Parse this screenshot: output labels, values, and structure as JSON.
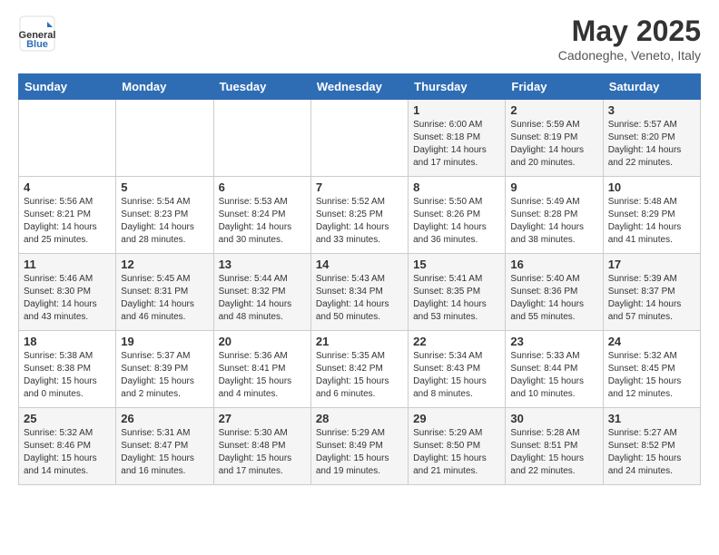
{
  "logo": {
    "general": "General",
    "blue": "Blue"
  },
  "title": "May 2025",
  "subtitle": "Cadoneghe, Veneto, Italy",
  "headers": [
    "Sunday",
    "Monday",
    "Tuesday",
    "Wednesday",
    "Thursday",
    "Friday",
    "Saturday"
  ],
  "weeks": [
    [
      {
        "day": "",
        "info": ""
      },
      {
        "day": "",
        "info": ""
      },
      {
        "day": "",
        "info": ""
      },
      {
        "day": "",
        "info": ""
      },
      {
        "day": "1",
        "info": "Sunrise: 6:00 AM\nSunset: 8:18 PM\nDaylight: 14 hours\nand 17 minutes."
      },
      {
        "day": "2",
        "info": "Sunrise: 5:59 AM\nSunset: 8:19 PM\nDaylight: 14 hours\nand 20 minutes."
      },
      {
        "day": "3",
        "info": "Sunrise: 5:57 AM\nSunset: 8:20 PM\nDaylight: 14 hours\nand 22 minutes."
      }
    ],
    [
      {
        "day": "4",
        "info": "Sunrise: 5:56 AM\nSunset: 8:21 PM\nDaylight: 14 hours\nand 25 minutes."
      },
      {
        "day": "5",
        "info": "Sunrise: 5:54 AM\nSunset: 8:23 PM\nDaylight: 14 hours\nand 28 minutes."
      },
      {
        "day": "6",
        "info": "Sunrise: 5:53 AM\nSunset: 8:24 PM\nDaylight: 14 hours\nand 30 minutes."
      },
      {
        "day": "7",
        "info": "Sunrise: 5:52 AM\nSunset: 8:25 PM\nDaylight: 14 hours\nand 33 minutes."
      },
      {
        "day": "8",
        "info": "Sunrise: 5:50 AM\nSunset: 8:26 PM\nDaylight: 14 hours\nand 36 minutes."
      },
      {
        "day": "9",
        "info": "Sunrise: 5:49 AM\nSunset: 8:28 PM\nDaylight: 14 hours\nand 38 minutes."
      },
      {
        "day": "10",
        "info": "Sunrise: 5:48 AM\nSunset: 8:29 PM\nDaylight: 14 hours\nand 41 minutes."
      }
    ],
    [
      {
        "day": "11",
        "info": "Sunrise: 5:46 AM\nSunset: 8:30 PM\nDaylight: 14 hours\nand 43 minutes."
      },
      {
        "day": "12",
        "info": "Sunrise: 5:45 AM\nSunset: 8:31 PM\nDaylight: 14 hours\nand 46 minutes."
      },
      {
        "day": "13",
        "info": "Sunrise: 5:44 AM\nSunset: 8:32 PM\nDaylight: 14 hours\nand 48 minutes."
      },
      {
        "day": "14",
        "info": "Sunrise: 5:43 AM\nSunset: 8:34 PM\nDaylight: 14 hours\nand 50 minutes."
      },
      {
        "day": "15",
        "info": "Sunrise: 5:41 AM\nSunset: 8:35 PM\nDaylight: 14 hours\nand 53 minutes."
      },
      {
        "day": "16",
        "info": "Sunrise: 5:40 AM\nSunset: 8:36 PM\nDaylight: 14 hours\nand 55 minutes."
      },
      {
        "day": "17",
        "info": "Sunrise: 5:39 AM\nSunset: 8:37 PM\nDaylight: 14 hours\nand 57 minutes."
      }
    ],
    [
      {
        "day": "18",
        "info": "Sunrise: 5:38 AM\nSunset: 8:38 PM\nDaylight: 15 hours\nand 0 minutes."
      },
      {
        "day": "19",
        "info": "Sunrise: 5:37 AM\nSunset: 8:39 PM\nDaylight: 15 hours\nand 2 minutes."
      },
      {
        "day": "20",
        "info": "Sunrise: 5:36 AM\nSunset: 8:41 PM\nDaylight: 15 hours\nand 4 minutes."
      },
      {
        "day": "21",
        "info": "Sunrise: 5:35 AM\nSunset: 8:42 PM\nDaylight: 15 hours\nand 6 minutes."
      },
      {
        "day": "22",
        "info": "Sunrise: 5:34 AM\nSunset: 8:43 PM\nDaylight: 15 hours\nand 8 minutes."
      },
      {
        "day": "23",
        "info": "Sunrise: 5:33 AM\nSunset: 8:44 PM\nDaylight: 15 hours\nand 10 minutes."
      },
      {
        "day": "24",
        "info": "Sunrise: 5:32 AM\nSunset: 8:45 PM\nDaylight: 15 hours\nand 12 minutes."
      }
    ],
    [
      {
        "day": "25",
        "info": "Sunrise: 5:32 AM\nSunset: 8:46 PM\nDaylight: 15 hours\nand 14 minutes."
      },
      {
        "day": "26",
        "info": "Sunrise: 5:31 AM\nSunset: 8:47 PM\nDaylight: 15 hours\nand 16 minutes."
      },
      {
        "day": "27",
        "info": "Sunrise: 5:30 AM\nSunset: 8:48 PM\nDaylight: 15 hours\nand 17 minutes."
      },
      {
        "day": "28",
        "info": "Sunrise: 5:29 AM\nSunset: 8:49 PM\nDaylight: 15 hours\nand 19 minutes."
      },
      {
        "day": "29",
        "info": "Sunrise: 5:29 AM\nSunset: 8:50 PM\nDaylight: 15 hours\nand 21 minutes."
      },
      {
        "day": "30",
        "info": "Sunrise: 5:28 AM\nSunset: 8:51 PM\nDaylight: 15 hours\nand 22 minutes."
      },
      {
        "day": "31",
        "info": "Sunrise: 5:27 AM\nSunset: 8:52 PM\nDaylight: 15 hours\nand 24 minutes."
      }
    ]
  ]
}
